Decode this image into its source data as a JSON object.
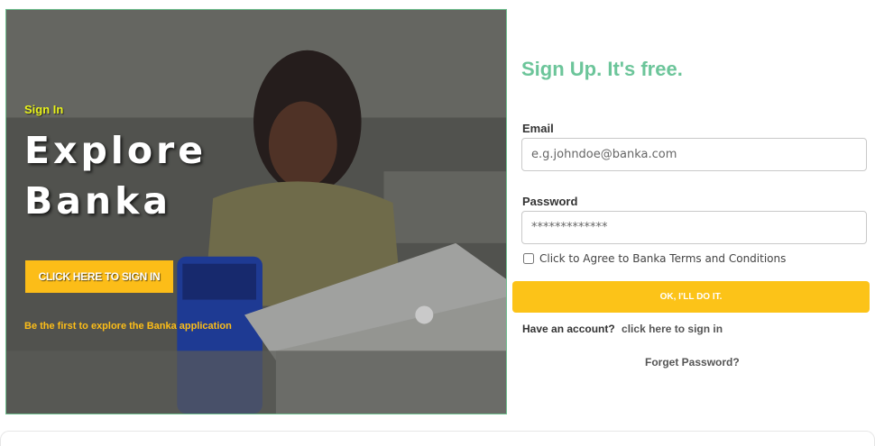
{
  "hero": {
    "signin_link": "Sign In",
    "title_line1": "Explore",
    "title_line2": "Banka",
    "cta_label": "CLICK HERE TO SIGN IN",
    "tagline": "Be the first to explore the Banka application"
  },
  "form": {
    "title": "Sign Up. It's free.",
    "email": {
      "label": "Email",
      "placeholder": "e.g.johndoe@banka.com",
      "value": ""
    },
    "password": {
      "label": "Password",
      "placeholder": "*************",
      "value": ""
    },
    "terms_label": "Click to Agree to Banka Terms and Conditions",
    "terms_checked": false,
    "submit_label": "OK, I'LL DO IT.",
    "have_account_text": "Have an account?",
    "signin_link": "click here to sign in",
    "forget_password": "Forget Password?"
  },
  "colors": {
    "accent_yellow": "#fcbd18",
    "title_green": "#6cc59a",
    "hero_signin_yellow": "#e8f21a"
  }
}
